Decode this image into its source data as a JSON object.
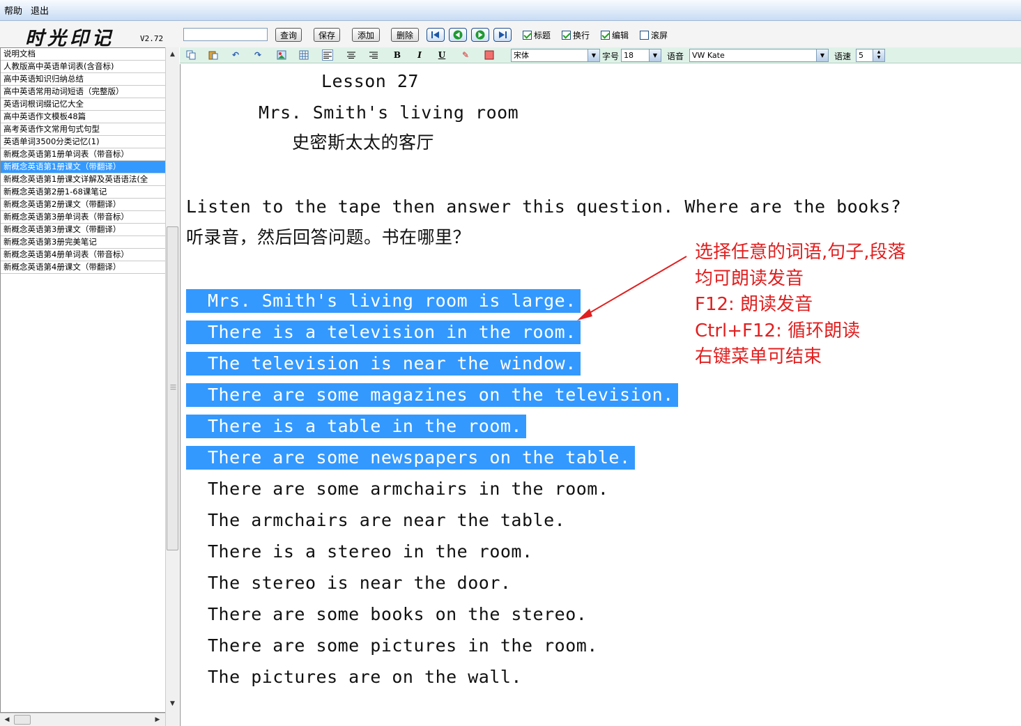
{
  "menu": {
    "help": "帮助",
    "exit": "退出"
  },
  "app": {
    "logo": "时光印记",
    "version": "V2.72"
  },
  "toolbar": {
    "search_value": "",
    "query": "查询",
    "save": "保存",
    "add": "添加",
    "delete": "删除",
    "checkboxes": [
      {
        "label": "标题",
        "checked": true
      },
      {
        "label": "换行",
        "checked": true
      },
      {
        "label": "编辑",
        "checked": true
      },
      {
        "label": "滚屏",
        "checked": false
      }
    ]
  },
  "sidebar": {
    "items": [
      "说明文档",
      "人教版高中英语单词表(含音标)",
      "高中英语知识归纳总结",
      "高中英语常用动词短语（完整版）",
      "英语词根词缀记忆大全",
      "高中英语作文模板48篇",
      "高考英语作文常用句式句型",
      "英语单词3500分类记忆(1)",
      "新概念英语第1册单词表（带音标）",
      "新概念英语第1册课文（带翻译）",
      "新概念英语第1册课文详解及英语语法(全",
      "新概念英语第2册1-68课笔记",
      "新概念英语第2册课文（带翻译）",
      "新概念英语第3册单词表（带音标）",
      "新概念英语第3册课文（带翻译）",
      "新概念英语第3册完美笔记",
      "新概念英语第4册单词表（带音标）",
      "新概念英语第4册课文（带翻译）"
    ],
    "selected_index": 9
  },
  "format": {
    "font": "宋体",
    "size_label": "字号",
    "size": "18",
    "voice_label": "语音",
    "voice": "VW Kate",
    "speed_label": "语速",
    "speed": "5"
  },
  "content": {
    "title": "Lesson 27",
    "subtitle": "Mrs. Smith's living room",
    "subtitle_cn": "史密斯太太的客厅",
    "question": "Listen to the tape then answer this question. Where are the books?",
    "question_cn": "听录音，然后回答问题。书在哪里？",
    "highlighted_lines": [
      "Mrs. Smith's living room is large.",
      "There is a television in the room.",
      "The television is near the window.",
      "There are some magazines on the television.",
      "There is a table in the room.",
      "There are some newspapers on the table."
    ],
    "lines": [
      "There are some armchairs in the room.",
      "The armchairs are near the table.",
      "There is a stereo in the room.",
      "The stereo is near the door.",
      "There are some books on the stereo.",
      "There are some pictures in the room.",
      "The pictures are on the wall."
    ]
  },
  "annotation": {
    "lines": [
      "选择任意的词语,句子,段落",
      "均可朗读发音",
      "F12: 朗读发音",
      "Ctrl+F12: 循环朗读",
      "右键菜单可结束"
    ],
    "color": "#e02020"
  },
  "colors": {
    "selection": "#3399ff",
    "format_bar": "#dff2e8"
  }
}
